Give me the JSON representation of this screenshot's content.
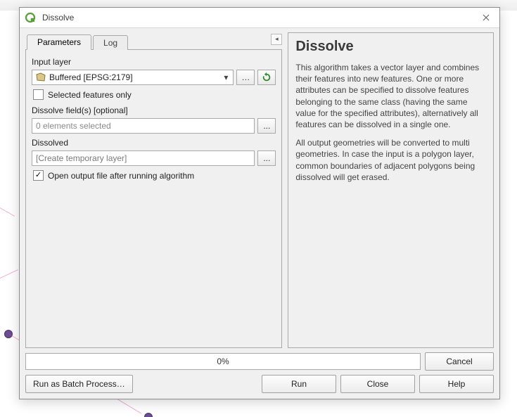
{
  "window": {
    "title": "Dissolve"
  },
  "tabs": {
    "parameters": "Parameters",
    "log": "Log"
  },
  "form": {
    "input_layer_label": "Input layer",
    "input_layer_value": "Buffered [EPSG:2179]",
    "input_layer_options_btn": "…",
    "selected_only_label": "Selected features only",
    "dissolve_fields_label": "Dissolve field(s) [optional]",
    "dissolve_fields_value": "0 elements selected",
    "dissolve_fields_browse": "...",
    "dissolved_label": "Dissolved",
    "dissolved_value": "[Create temporary layer]",
    "dissolved_browse": "...",
    "open_output_label": "Open output file after running algorithm"
  },
  "help": {
    "title": "Dissolve",
    "p1": "This algorithm takes a vector layer and combines their features into new features. One or more attributes can be specified to dissolve features belonging to the same class (having the same value for the specified attributes), alternatively all features can be dissolved in a single one.",
    "p2": "All output geometries will be converted to multi geometries. In case the input is a polygon layer, common boundaries of adjacent polygons being dissolved will get erased."
  },
  "progress": {
    "text": "0%",
    "cancel": "Cancel"
  },
  "buttons": {
    "batch": "Run as Batch Process…",
    "run": "Run",
    "close": "Close",
    "help_btn": "Help"
  }
}
